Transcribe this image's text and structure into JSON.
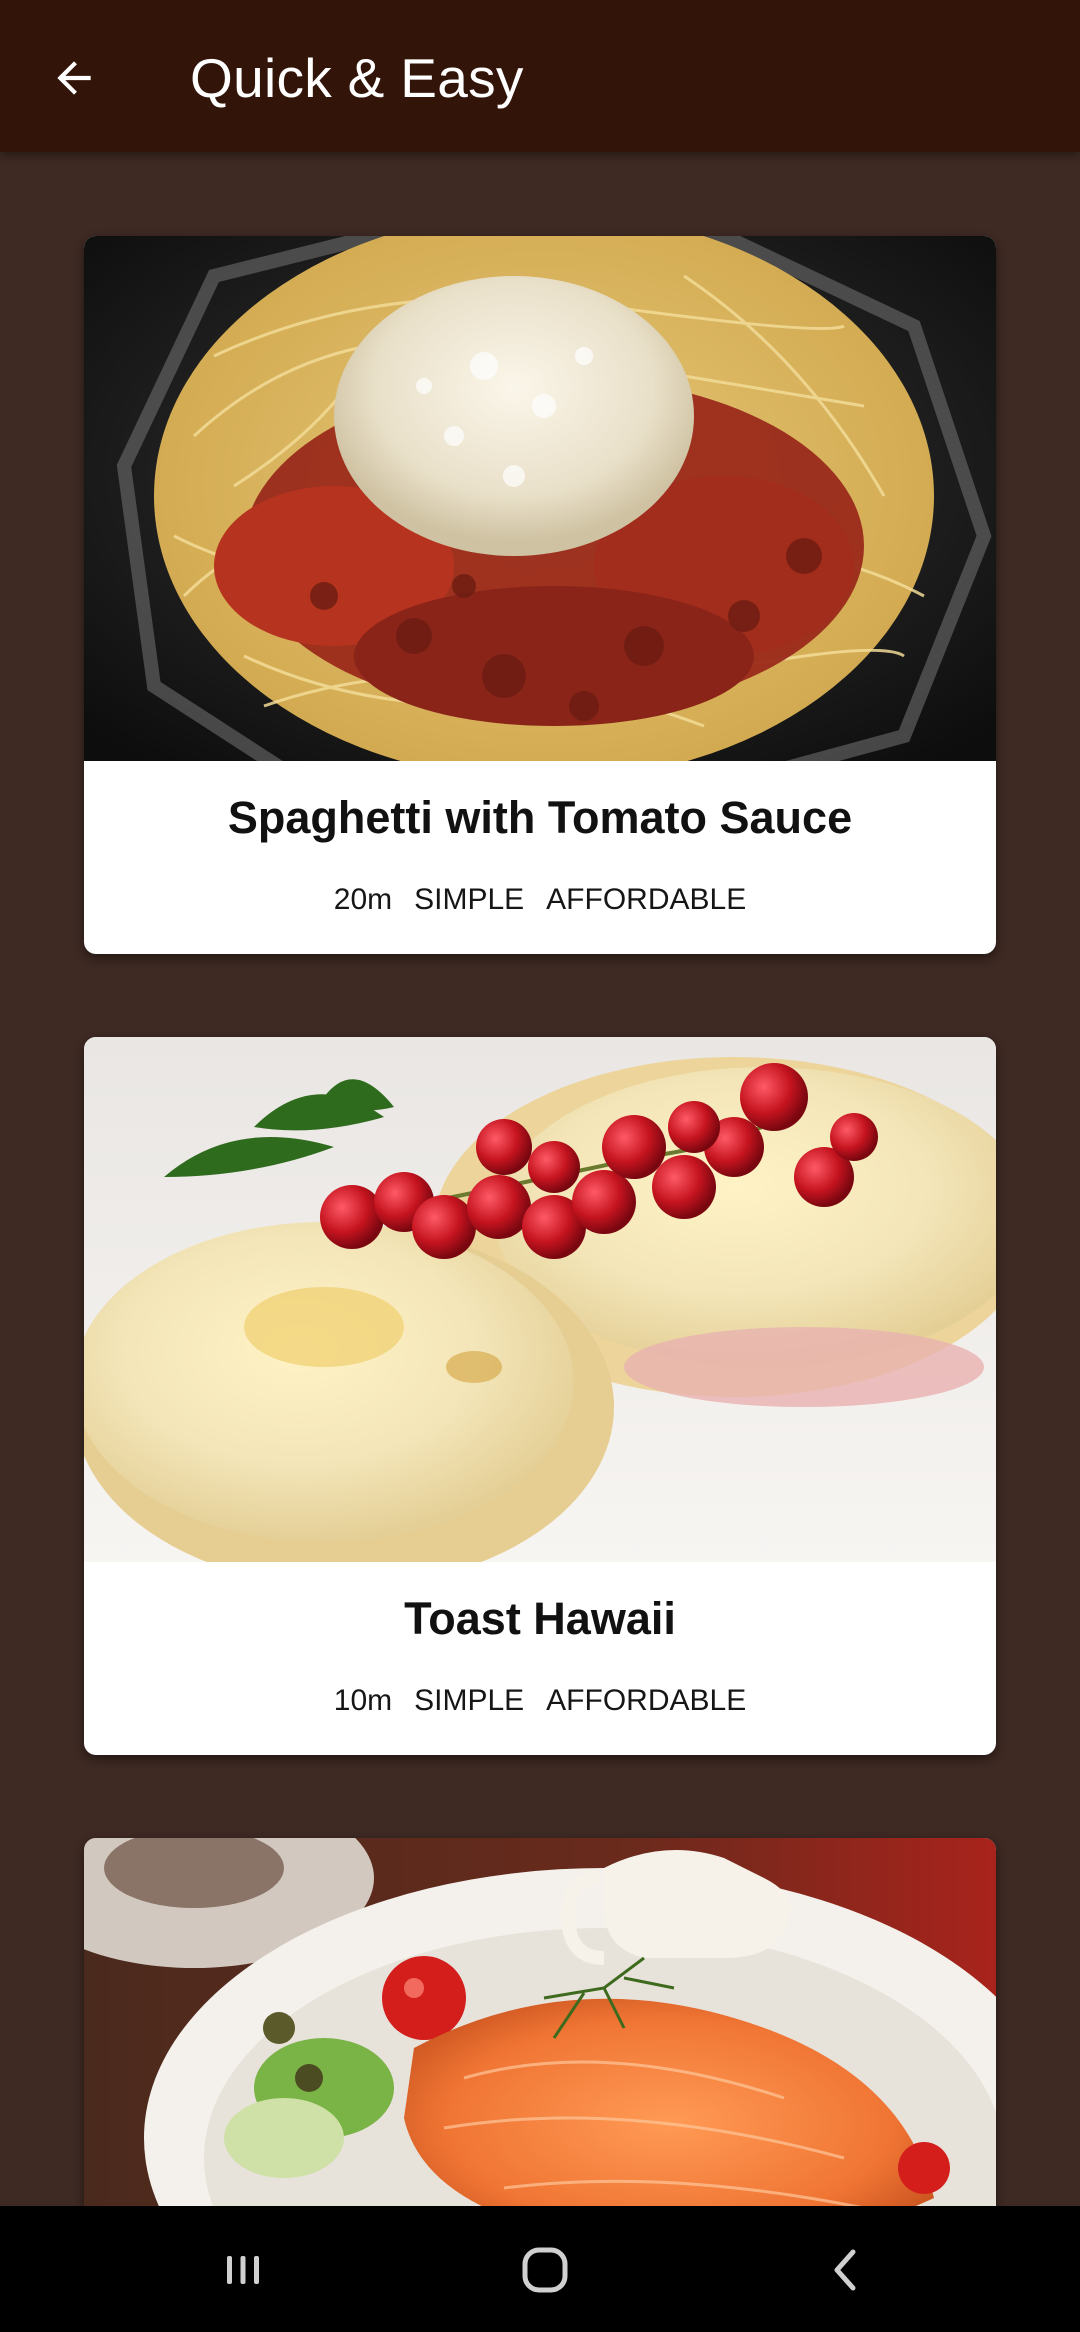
{
  "app_bar": {
    "title": "Quick & Easy",
    "back_icon": "arrow-left-icon",
    "background": "#321408"
  },
  "page": {
    "background": "#3e2923"
  },
  "meals": [
    {
      "title": "Spaghetti with Tomato Sauce",
      "duration": "20m",
      "complexity": "SIMPLE",
      "affordability": "AFFORDABLE",
      "image": "spaghetti-bolognese-photo"
    },
    {
      "title": "Toast Hawaii",
      "duration": "10m",
      "complexity": "SIMPLE",
      "affordability": "AFFORDABLE",
      "image": "toast-hawaii-photo"
    },
    {
      "image": "smoked-salmon-salad-photo"
    }
  ],
  "nav_bar": {
    "recent_icon": "recent-apps-icon",
    "home_icon": "home-icon",
    "back_icon": "system-back-icon"
  }
}
